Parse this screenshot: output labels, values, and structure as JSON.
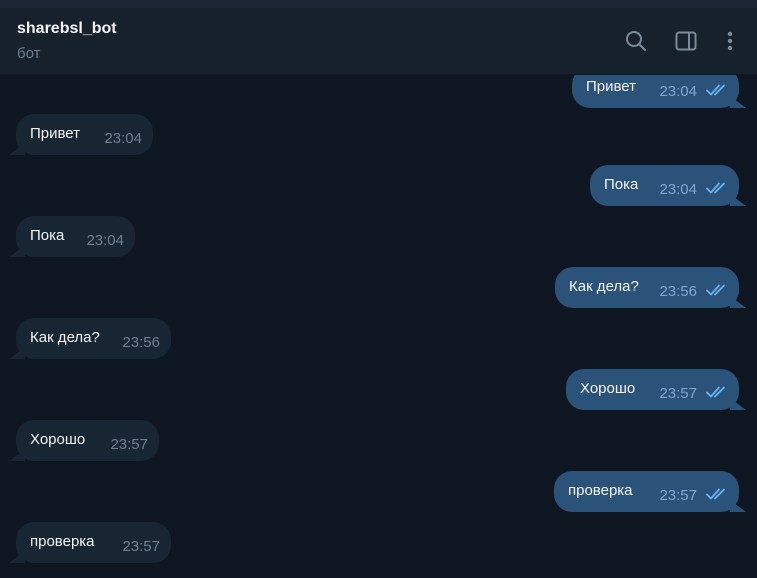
{
  "header": {
    "title": "sharebsl_bot",
    "subtitle": "бот",
    "icons": [
      "search-icon",
      "sidebar-panel-icon",
      "more-vertical-icon"
    ]
  },
  "messages": [
    {
      "dir": "out",
      "text": "Привет",
      "time": "23:04",
      "status": "read"
    },
    {
      "dir": "in",
      "text": "Привет",
      "time": "23:04"
    },
    {
      "dir": "out",
      "text": "Пока",
      "time": "23:04",
      "status": "read"
    },
    {
      "dir": "in",
      "text": "Пока",
      "time": "23:04"
    },
    {
      "dir": "out",
      "text": "Как дела?",
      "time": "23:56",
      "status": "read"
    },
    {
      "dir": "in",
      "text": "Как дела?",
      "time": "23:56"
    },
    {
      "dir": "out",
      "text": "Хорошо",
      "time": "23:57",
      "status": "read"
    },
    {
      "dir": "in",
      "text": "Хорошо",
      "time": "23:57"
    },
    {
      "dir": "out",
      "text": "проверка",
      "time": "23:57",
      "status": "read"
    },
    {
      "dir": "in",
      "text": "проверка",
      "time": "23:57"
    }
  ],
  "colors": {
    "background": "#0e1621",
    "header": "#17212b",
    "bubble_in": "#182533",
    "bubble_out": "#2b5278",
    "read_check": "#6ab3f3"
  }
}
